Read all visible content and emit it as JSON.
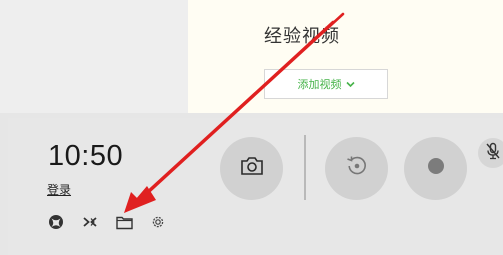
{
  "web_page": {
    "title": "经验视频",
    "add_video_label": "添加视频"
  },
  "game_bar": {
    "time": "10:50",
    "login_label": "登录"
  },
  "icons": {
    "xbox": "xbox-icon",
    "social": "xbox-social-icon",
    "folder": "folder-icon",
    "settings": "gear-icon",
    "screenshot": "camera-icon",
    "record_last": "replay-record-icon",
    "record": "record-dot-icon",
    "mic": "mic-off-icon"
  },
  "colors": {
    "annotation_arrow": "#e02020",
    "add_video_text": "#46b349",
    "web_background": "#fffdf3",
    "game_bar_background": "#e6e6e6"
  }
}
